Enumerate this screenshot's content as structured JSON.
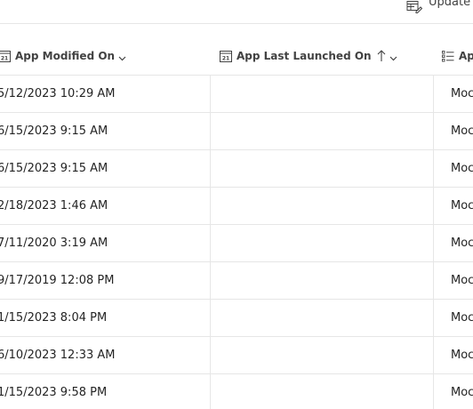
{
  "command_bar": {
    "update_label": "Update t"
  },
  "columns": [
    {
      "label": "App Modified On",
      "icon": "calendar-icon"
    },
    {
      "label": "App Last Launched On",
      "icon": "calendar-icon",
      "sort": "ascending"
    },
    {
      "label": "Ap",
      "icon": "list-icon"
    }
  ],
  "rows": [
    {
      "modified": "5/12/2023 10:29 AM",
      "launched": "",
      "app": "Moc"
    },
    {
      "modified": "6/15/2023 9:15 AM",
      "launched": "",
      "app": "Moc"
    },
    {
      "modified": "6/15/2023 9:15 AM",
      "launched": "",
      "app": "Moc"
    },
    {
      "modified": "2/18/2023 1:46 AM",
      "launched": "",
      "app": "Moc"
    },
    {
      "modified": "7/11/2020 3:19 AM",
      "launched": "",
      "app": "Moc"
    },
    {
      "modified": "9/17/2019 12:08 PM",
      "launched": "",
      "app": "Moc"
    },
    {
      "modified": "1/15/2023 8:04 PM",
      "launched": "",
      "app": "Moc"
    },
    {
      "modified": "6/10/2023 12:33 AM",
      "launched": "",
      "app": "Moc"
    },
    {
      "modified": "1/15/2023 9:58 PM",
      "launched": "",
      "app": "Moc"
    }
  ]
}
